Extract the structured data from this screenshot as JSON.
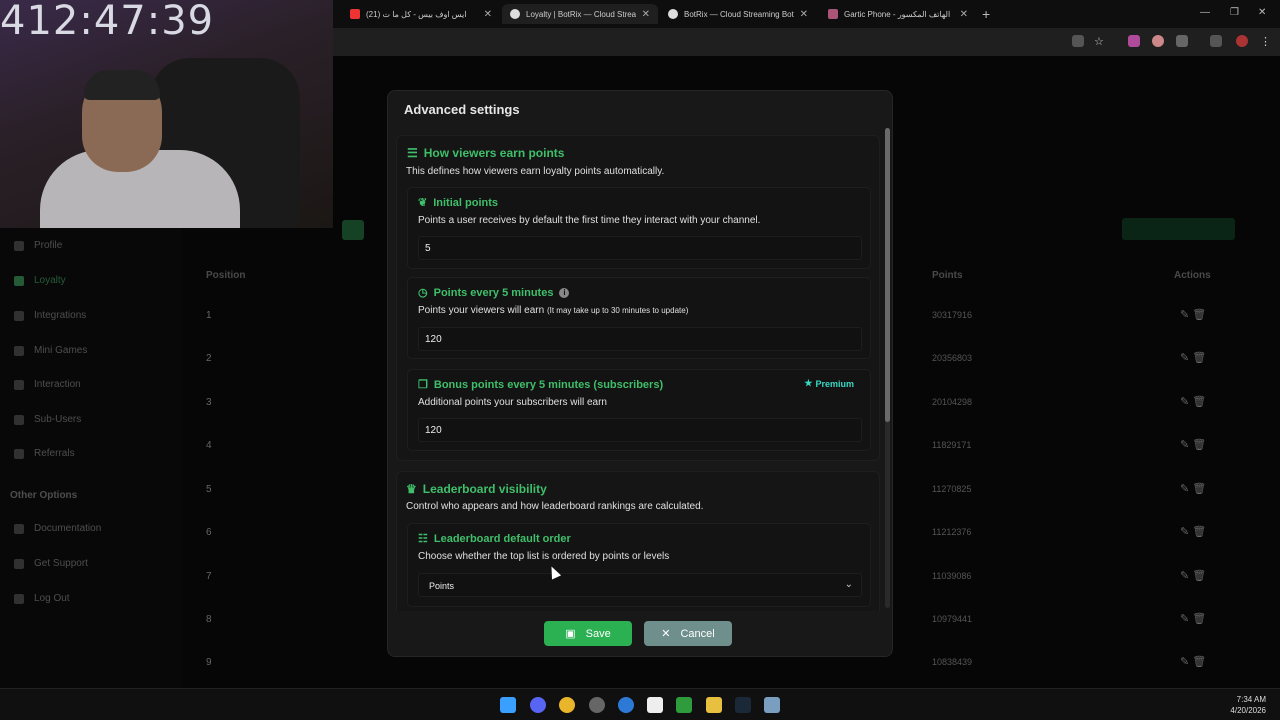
{
  "stream_timer": "412:47:39",
  "browser": {
    "tabs": [
      {
        "title": "(21) ايس اوف بيس - كل ما ت",
        "active": false
      },
      {
        "title": "Loyalty | BotRix — Cloud Streaming Bot",
        "active": true
      },
      {
        "title": "BotRix — Cloud Streaming Bot",
        "active": false
      },
      {
        "title": "Gartic Phone - الهاتف المكسور",
        "active": false
      }
    ],
    "new_tab": "+"
  },
  "background_page": {
    "sidebar": [
      "Profile",
      "Loyalty",
      "Integrations",
      "Mini Games",
      "Interaction",
      "Sub-Users",
      "Referrals"
    ],
    "other_options_heading": "Other Options",
    "other_options": [
      "Documentation",
      "Get Support",
      "Log Out"
    ],
    "table_headers": {
      "position": "Position",
      "points": "Points",
      "actions": "Actions"
    },
    "rows": [
      {
        "pos": "1",
        "points": "30317916"
      },
      {
        "pos": "2",
        "points": "20356803"
      },
      {
        "pos": "3",
        "points": "20104298"
      },
      {
        "pos": "4",
        "points": "11829171"
      },
      {
        "pos": "5",
        "points": "11270825"
      },
      {
        "pos": "6",
        "points": "11212376"
      },
      {
        "pos": "7",
        "points": "11039086"
      },
      {
        "pos": "8",
        "points": "10979441"
      },
      {
        "pos": "9",
        "points": "10838439"
      }
    ]
  },
  "modal": {
    "title": "Advanced settings",
    "earn_section": {
      "title": "How viewers earn points",
      "description": "This defines how viewers earn loyalty points automatically.",
      "initial": {
        "title": "Initial points",
        "description": "Points a user receives by default the first time they interact with your channel.",
        "value": "5"
      },
      "every5": {
        "title": "Points every 5 minutes",
        "description": "Points your viewers will earn",
        "note": "(It may take up to 30 minutes to update)",
        "value": "120"
      },
      "bonus": {
        "title": "Bonus points every 5 minutes (subscribers)",
        "badge": "Premium",
        "description": "Additional points your subscribers will earn",
        "value": "120"
      }
    },
    "leaderboard_section": {
      "title": "Leaderboard visibility",
      "description": "Control who appears and how leaderboard rankings are calculated.",
      "order": {
        "title": "Leaderboard default order",
        "description": "Choose whether the top list is ordered by points or levels",
        "selected": "Points"
      }
    },
    "save_label": "Save",
    "cancel_label": "Cancel"
  },
  "taskbar": {
    "time": "7:34 AM",
    "date": "4/20/2026"
  }
}
